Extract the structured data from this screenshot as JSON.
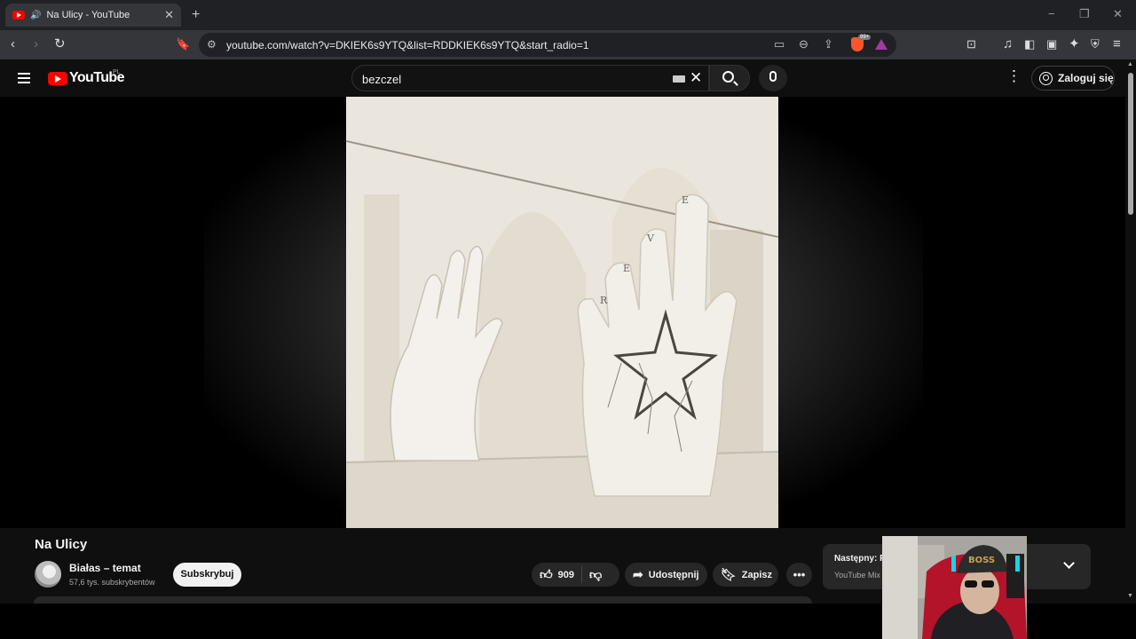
{
  "browser": {
    "tab": {
      "title": "Na Ulicy - YouTube",
      "audio_icon": "speaker-icon"
    },
    "new_tab_glyph": "+",
    "window_controls": [
      "−",
      "❐",
      "✕"
    ],
    "url": "youtube.com/watch?v=DKIEK6s9YTQ&list=RDDKIEK6s9YTQ&start_radio=1",
    "brave_badge": "99+"
  },
  "youtube": {
    "logo_text": "YouTube",
    "country_code": "PL",
    "search": {
      "query": "bezczel"
    },
    "signin_label": "Zaloguj się"
  },
  "video": {
    "frame_letters": [
      "E",
      "V",
      "E",
      "R"
    ],
    "title": "Na Ulicy",
    "channel": "Białas – temat",
    "subscribers": "57,6 tys. subskrybentów",
    "subscribe_label": "Subskrybuj",
    "likes": "909",
    "share_label": "Udostępnij",
    "save_label": "Zapisz"
  },
  "next_card": {
    "label": "Następny: F",
    "sublabel": "YouTube Mix"
  },
  "webcam": {
    "cap_text": "BOSS"
  },
  "colors": {
    "brand_red": "#ff0000",
    "page_bg": "#0f0f0f",
    "chip_bg": "#272727"
  }
}
